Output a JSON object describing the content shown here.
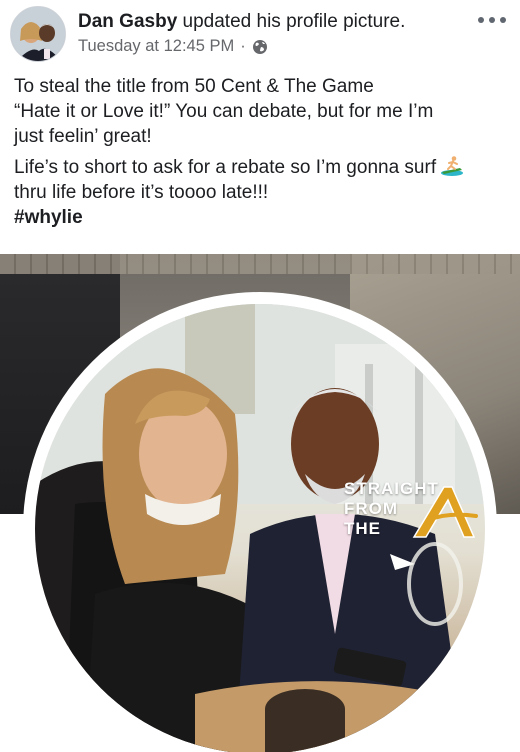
{
  "header": {
    "author_name": "Dan Gasby",
    "action_text": " updated his profile picture.",
    "timestamp": "Tuesday at 12:45 PM",
    "separator": "·",
    "privacy_icon": "globe-icon",
    "menu_icon": "more-options-icon"
  },
  "post": {
    "lines_p1": [
      "To steal the title from 50 Cent & The Game",
      "“Hate it or Love it!” You can debate, but for me I’m",
      "just feelin’ great!"
    ],
    "lines_p2": [
      "Life’s to short to ask for a rebate so I’m gonna surf",
      "thru life before it’s toooo late!!!"
    ],
    "hashtag": "#whylie",
    "emoji_icon": "surfer-icon"
  },
  "watermark": {
    "line1": "STRAIGHT",
    "line2": "FROM",
    "line3": "THE"
  },
  "colors": {
    "text": "#1c1e21",
    "meta": "#65676b",
    "accent": "#e0a020"
  }
}
